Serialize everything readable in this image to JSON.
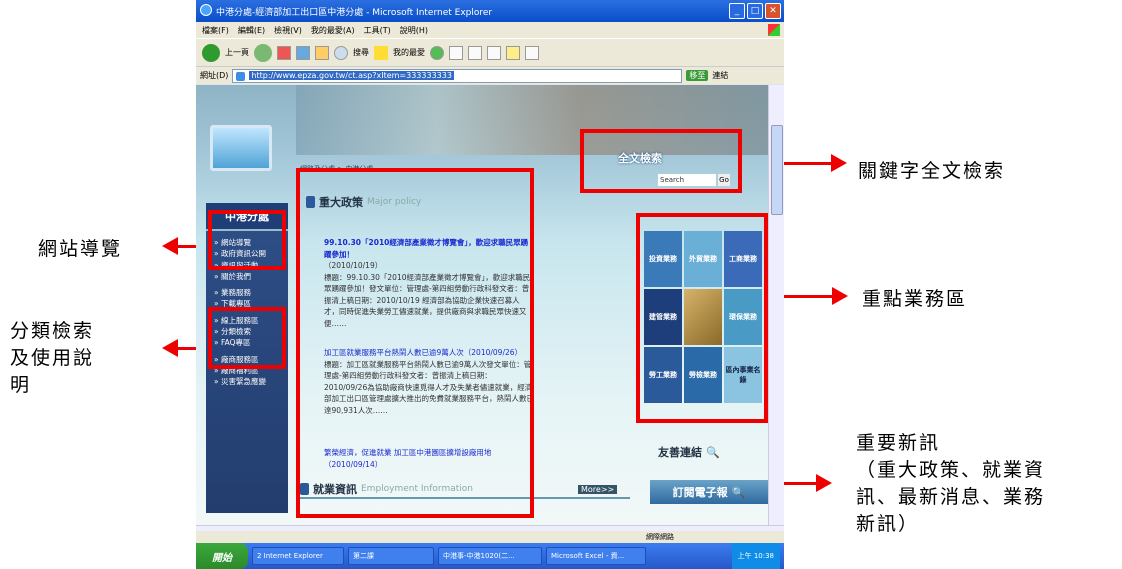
{
  "annotations": {
    "fulltext_search": "關鍵字全文檢索",
    "site_nav": "網站導覽",
    "category_search": [
      "分類檢索",
      "及使用說",
      "明"
    ],
    "key_services": "重點業務區",
    "important_news": [
      "重要新訊",
      "（重大政策、就業資",
      "訊、最新消息、業務",
      "新訊）"
    ]
  },
  "window": {
    "title": "中港分處-經濟部加工出口區中港分處 - Microsoft Internet Explorer",
    "menu": [
      "檔案(F)",
      "編輯(E)",
      "檢視(V)",
      "我的最愛(A)",
      "工具(T)",
      "說明(H)"
    ],
    "toolbar": {
      "back": "上一頁",
      "search": "搜尋",
      "favorites": "我的最愛"
    },
    "address_label": "網址(D)",
    "address": "http://www.epza.gov.tw/ct.asp?xItem=333333333",
    "go": "移至",
    "links": "連結"
  },
  "site": {
    "breadcrumb": "網路及分處 > 中港分處",
    "sidebar_title": "中港分處",
    "nav_group_1": [
      "網站導覽",
      "政府資訊公開",
      "資訊與活動",
      "關於我們"
    ],
    "nav_group_2": [
      "業務服務",
      "下載專區"
    ],
    "nav_group_3": [
      "線上服務區",
      "分類檢索",
      "FAQ專區"
    ],
    "nav_group_4": [
      "廠商服務區",
      "廠商福利區",
      "災害緊急應變"
    ],
    "search": {
      "title": "全文檢索",
      "placeholder": "Search",
      "button": "Go"
    },
    "policy": {
      "title": "重大政策",
      "subtitle": "Major policy"
    },
    "news": [
      {
        "title": "99.10.30「2010經濟部產業徵才博覽會」，歡迎求職民眾踴躍參加！",
        "date": "（2010/10/19）",
        "body": "標題：99.10.30「2010經濟部產業徵才博覽會」，歡迎求職民眾踴躍參加！發文單位：管理處-第四組勞動行政科發文者：曾振清上稿日期：2010/10/19 經濟部為協助企業快速召募人才，同時促進失業勞工儘速就業，提供廠商與求職民眾快速又便……"
      },
      {
        "title": "加工區就業服務平台熱鬧人數已逾9萬人次",
        "date": "（2010/09/26）",
        "body": "標題：加工區就業服務平台熱鬧人數已逾9萬人次發文單位：管理處-第四組勞動行政科發文者：曾振清上稿日期：2010/09/26為協助廠商快速覓得人才及失業者儘速就業，經濟部加工出口區管理處擴大推出的免費就業服務平台，熱鬧人數已達90,931人次……"
      },
      {
        "title": "繁榮經濟，促進就業 加工區中港園區擴增設廠用地",
        "date": "（2010/09/14）"
      }
    ],
    "services": [
      "投資業務",
      "外貿業務",
      "工商業務",
      "建管業務",
      "",
      "環保業務",
      "勞工業務",
      "勞檢業務",
      "區內事業名錄"
    ],
    "friend_links": "友善連結",
    "epaper": "訂閱電子報",
    "employment": {
      "title": "就業資訊",
      "subtitle": "Employment Information",
      "more": "More>>"
    }
  },
  "statusbar": {
    "zone": "網際網路"
  },
  "taskbar": {
    "start": "開始",
    "tasks": [
      "2 Internet Explorer",
      "第二課",
      "中港事-中港1020(二...",
      "Microsoft Excel - 資..."
    ],
    "clock": "上午 10:38"
  },
  "colors": {
    "highlight": "#e00000",
    "sidebar": "#2e4f88",
    "link": "#1a2ad0"
  }
}
